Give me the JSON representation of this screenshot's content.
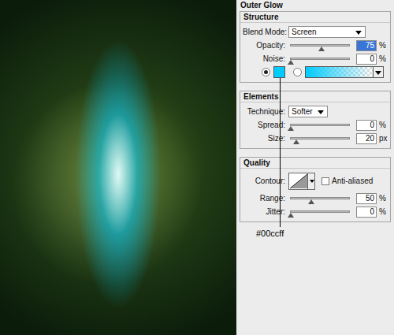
{
  "panel": {
    "title": "Outer Glow"
  },
  "structure": {
    "title": "Structure",
    "blend_mode": {
      "label": "Blend Mode:",
      "value": "Screen"
    },
    "sliders": [
      {
        "label": "Opacity:",
        "value": "75",
        "unit": "%",
        "level": 0.53,
        "selected": true
      },
      {
        "label": "Noise:",
        "value": "0",
        "unit": "%",
        "level": 0,
        "selected": false
      }
    ],
    "fill": [
      {
        "kind": "color",
        "selected": true,
        "color": "#00ccff"
      },
      {
        "kind": "gradient",
        "selected": false,
        "color": "#00ccff"
      }
    ]
  },
  "elements": {
    "title": "Elements",
    "technique": {
      "label": "Technique:",
      "value": "Softer"
    },
    "sliders": [
      {
        "label": "Spread:",
        "value": "0",
        "unit": "%",
        "level": 0,
        "selected": false
      },
      {
        "label": "Size:",
        "value": "20",
        "unit": "px",
        "level": 0.1,
        "selected": false
      }
    ]
  },
  "quality": {
    "title": "Quality",
    "contour": {
      "label": "Contour:"
    },
    "anti_aliased": {
      "label": "Anti-aliased",
      "checked": false
    },
    "sliders": [
      {
        "label": "Range:",
        "value": "50",
        "unit": "%",
        "level": 0.35,
        "selected": false
      },
      {
        "label": "Jitter:",
        "value": "0",
        "unit": "%",
        "level": 0,
        "selected": false
      }
    ]
  },
  "annotation": {
    "text": "#00ccff"
  }
}
